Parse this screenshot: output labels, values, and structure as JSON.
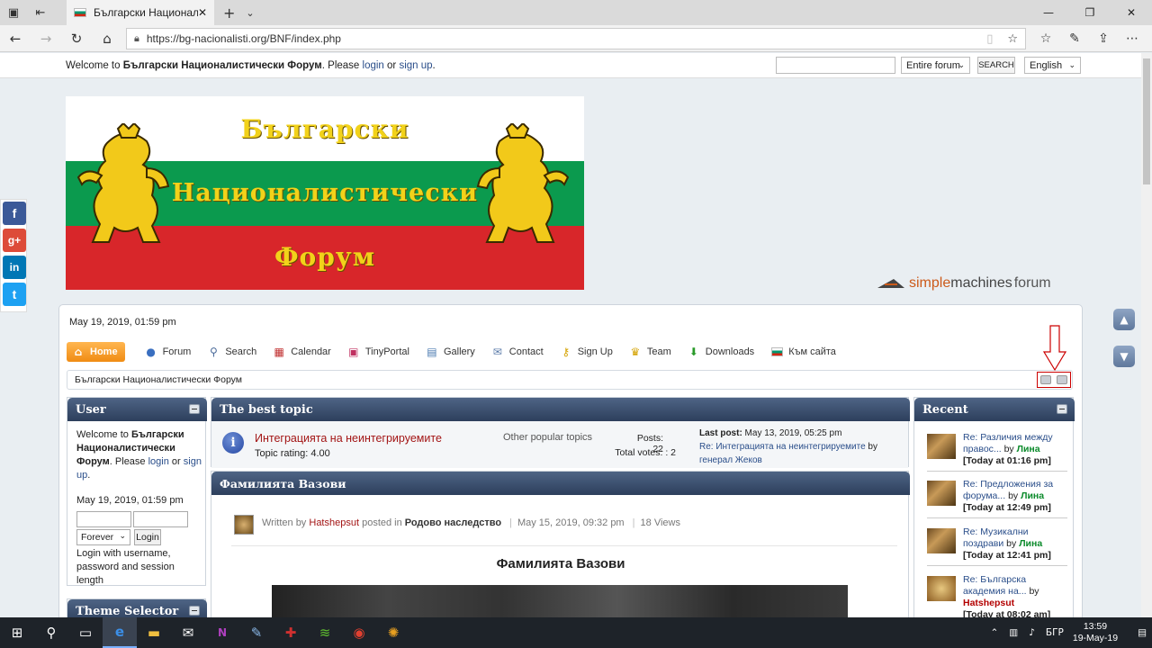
{
  "browser": {
    "tab_title": "Български Националис",
    "url": "https://bg-nacionalisti.org/BNF/index.php"
  },
  "topbar": {
    "welcome_prefix": "Welcome to ",
    "forum_name": "Български Националистически Форум",
    "please": ". Please ",
    "login": "login",
    "or": " or ",
    "signup": "sign up",
    "period": ".",
    "scope": "Entire forum",
    "search_btn": "SEARCH",
    "language": "English"
  },
  "banner": {
    "line1": "Български",
    "line2": "Националистически",
    "line3": "Форум"
  },
  "smf": {
    "s1": "simple",
    "s2": "machines",
    "s3": "forum"
  },
  "date_top": "May 19, 2019, 01:59 pm",
  "menu": [
    {
      "label": "Home",
      "icon": "home-icon"
    },
    {
      "label": "Forum",
      "icon": "forum-icon"
    },
    {
      "label": "Search",
      "icon": "search-icon"
    },
    {
      "label": "Calendar",
      "icon": "calendar-icon"
    },
    {
      "label": "TinyPortal",
      "icon": "tinyportal-icon"
    },
    {
      "label": "Gallery",
      "icon": "gallery-icon"
    },
    {
      "label": "Contact",
      "icon": "mail-icon"
    },
    {
      "label": "Sign Up",
      "icon": "key-icon"
    },
    {
      "label": "Team",
      "icon": "trophy-icon"
    },
    {
      "label": "Downloads",
      "icon": "download-icon"
    },
    {
      "label": "Към сайта",
      "icon": "bg-flag-icon"
    }
  ],
  "breadcrumb": "Български Националистически Форум",
  "user_panel": {
    "title": "User",
    "welcome_to": "Welcome to ",
    "forum_name": "Български Националистически Форум",
    "please": ". Please ",
    "login": "login",
    "or": " or ",
    "signup": "sign up",
    "period": ".",
    "date": "May 19, 2019, 01:59 pm",
    "duration": "Forever",
    "login_btn": "Login",
    "hint": "Login with username, password and session length"
  },
  "theme_panel": {
    "title": "Theme Selector"
  },
  "best_topic": {
    "title": "The best topic",
    "topic": "Интеграцията на неинтегрируемите",
    "rating": "Topic rating: 4.00",
    "other": "Other popular topics",
    "posts": "Posts: 22",
    "votes": "Total votes: : 2",
    "last_post_label": "Last post:",
    "last_post_date": " May 13, 2019, 05:25 pm",
    "last_post_re": "Re: Интеграцията на неинтегрируемите",
    "by": " by ",
    "author": "генерал Жеков"
  },
  "article": {
    "panel_title": "Фамилията Вазови",
    "written_by": "Written by ",
    "author": "Hatshepsut",
    "posted_in": " posted in ",
    "board": "Родово наследство",
    "date": "May 15, 2019, 09:32 pm",
    "views": "18 Views",
    "heading": "Фамилията Вазови"
  },
  "recent": {
    "title": "Recent",
    "items": [
      {
        "subject": "Re: Различия между правос...",
        "by": " by ",
        "author": "Лина",
        "time": "[Today at 01:16 pm]"
      },
      {
        "subject": "Re: Предложения за форума...",
        "by": " by ",
        "author": "Лина",
        "time": "[Today at 12:49 pm]"
      },
      {
        "subject": "Re: Музикални поздрави",
        "by": " by ",
        "author": "Лина",
        "time": "[Today at 12:41 pm]"
      },
      {
        "subject": "Re: Българска академия на...",
        "by": " by ",
        "author": "Hatshepsut",
        "time": "[Today at 08:02 am]"
      }
    ]
  },
  "taskbar": {
    "lang": "БГР",
    "time": "13:59",
    "date": "19-May-19"
  },
  "colors": {
    "accent_orange": "#f08c13",
    "panel_header": "#2d3f5c",
    "link": "#2a4e8a",
    "topic_red": "#a31515"
  }
}
